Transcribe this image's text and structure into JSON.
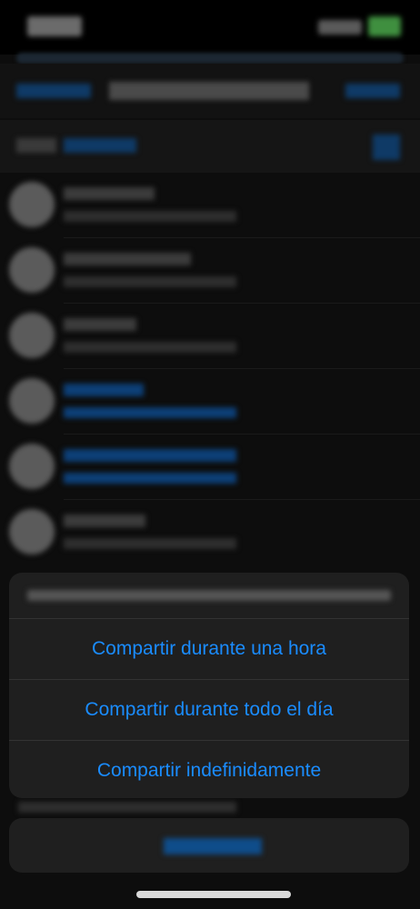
{
  "action_sheet": {
    "options": [
      {
        "label": "Compartir durante una hora"
      },
      {
        "label": "Compartir durante todo el día"
      },
      {
        "label": "Compartir indefinidamente"
      }
    ]
  },
  "colors": {
    "accent": "#1a8cff",
    "sheet_background": "#1f1f1f",
    "page_background": "#000000"
  }
}
